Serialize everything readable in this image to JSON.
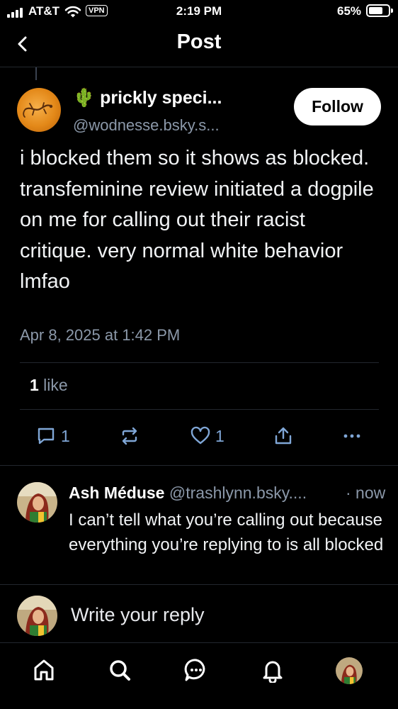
{
  "status_bar": {
    "carrier": "AT&T",
    "vpn": "VPN",
    "time": "2:19 PM",
    "battery": "65%"
  },
  "header": {
    "title": "Post"
  },
  "post": {
    "author_emoji": "🌵",
    "author_name": "prickly speci...",
    "author_handle": "@wodnesse.bsky.s...",
    "follow_label": "Follow",
    "text": "i blocked them so it shows as blocked. transfeminine review initiated a dogpile on me for calling out their racist critique. very normal white behavior lmfao",
    "date": "Apr 8, 2025 at 1:42 PM",
    "like_count": "1",
    "like_word": " like",
    "actions": {
      "reply_count": "1",
      "like_count": "1"
    }
  },
  "reply": {
    "name": "Ash Méduse",
    "handle": "@trashlynn.bsky....",
    "time": "· now",
    "text": "I can’t tell what you’re calling out because everything you’re replying to is all blocked"
  },
  "compose": {
    "placeholder": "Write your reply"
  },
  "colors": {
    "background": "#000000",
    "muted": "#8b98a9",
    "action_blue": "#7fa6d6",
    "separator": "#22272e"
  }
}
